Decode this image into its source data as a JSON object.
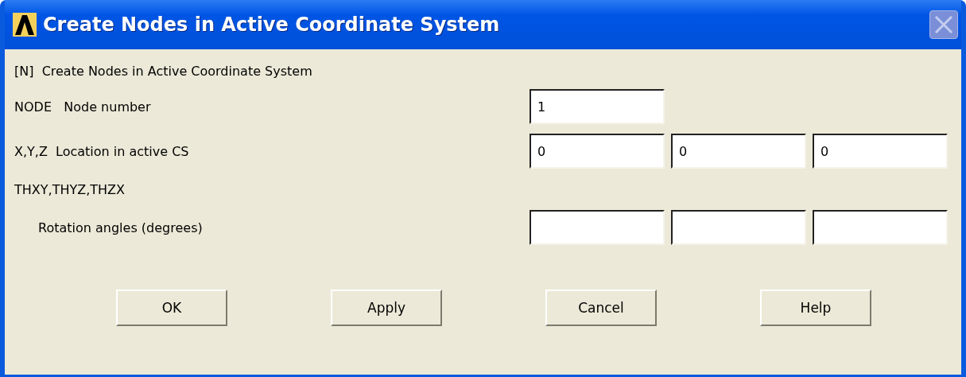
{
  "window": {
    "title": "Create Nodes in Active Coordinate System",
    "close_disabled": true
  },
  "heading": "[N]  Create Nodes in Active Coordinate System",
  "rows": [
    {
      "kind": "fields",
      "label": "NODE   Node number",
      "fields": [
        {
          "kind": "text",
          "value": "1"
        }
      ]
    },
    {
      "kind": "fields",
      "label": "X,Y,Z  Location in active CS",
      "fields": [
        {
          "kind": "text",
          "value": "0"
        },
        {
          "kind": "text",
          "value": "0"
        },
        {
          "kind": "text",
          "value": "0"
        }
      ]
    },
    {
      "kind": "caption",
      "label": "THXY,THYZ,THZX"
    },
    {
      "kind": "fields",
      "label": "Rotation angles (degrees)",
      "indent": true,
      "fields": [
        {
          "kind": "text"
        },
        {
          "kind": "text"
        },
        {
          "kind": "text"
        }
      ]
    }
  ],
  "buttons": [
    "OK",
    "Apply",
    "Cancel",
    "Help"
  ]
}
